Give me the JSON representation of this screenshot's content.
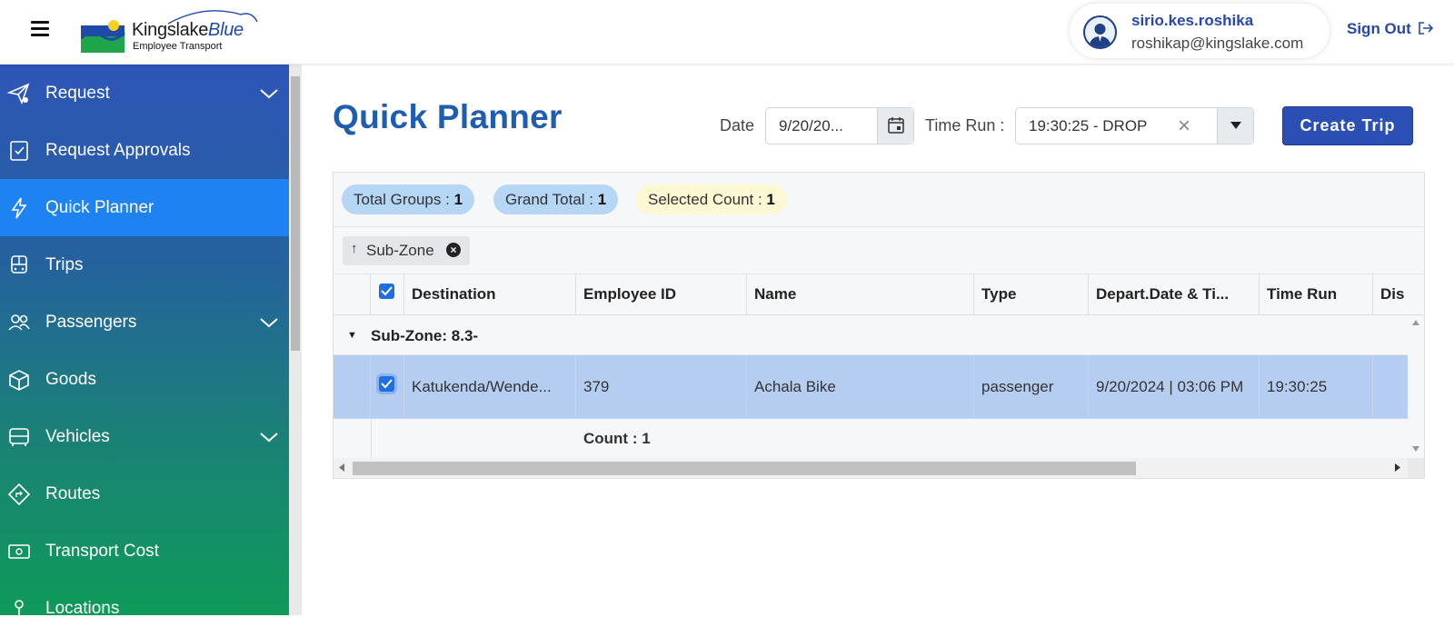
{
  "header": {
    "logo_title_main": "Kingslake",
    "logo_title_accent": "Blue",
    "logo_subtitle": "Employee Transport",
    "user_name": "sirio.kes.roshika",
    "user_email": "roshikap@kingslake.com",
    "signout_label": "Sign Out"
  },
  "sidebar": {
    "items": [
      {
        "label": "Request",
        "icon": "send-icon",
        "expandable": true
      },
      {
        "label": "Request Approvals",
        "icon": "approval-icon",
        "expandable": false
      },
      {
        "label": "Quick Planner",
        "icon": "lightning-icon",
        "expandable": false,
        "active": true
      },
      {
        "label": "Trips",
        "icon": "bus-front-icon",
        "expandable": false
      },
      {
        "label": "Passengers",
        "icon": "people-icon",
        "expandable": true
      },
      {
        "label": "Goods",
        "icon": "box-icon",
        "expandable": false
      },
      {
        "label": "Vehicles",
        "icon": "bus-icon",
        "expandable": true
      },
      {
        "label": "Routes",
        "icon": "route-sign-icon",
        "expandable": false
      },
      {
        "label": "Transport Cost",
        "icon": "cash-icon",
        "expandable": false
      },
      {
        "label": "Locations",
        "icon": "location-icon",
        "expandable": false
      }
    ],
    "active_color": "#1e82f2"
  },
  "page": {
    "title": "Quick Planner",
    "date_label": "Date",
    "date_value": "9/20/20...",
    "time_run_label": "Time Run :",
    "time_run_value": "19:30:25 - DROP",
    "create_trip_label": "Create Trip"
  },
  "summary": {
    "total_groups_label": "Total Groups : ",
    "total_groups_value": "1",
    "grand_total_label": "Grand Total : ",
    "grand_total_value": "1",
    "selected_count_label": "Selected Count : ",
    "selected_count_value": "1"
  },
  "group_chip": {
    "label": "Sub-Zone",
    "sort": "ascending"
  },
  "table": {
    "columns": [
      "Destination",
      "Employee ID",
      "Name",
      "Type",
      "Depart.Date & Ti...",
      "Time Run",
      "Dis"
    ],
    "group_row": "Sub-Zone: 8.3-",
    "rows": [
      {
        "selected": true,
        "destination": "Katukenda/Wende...",
        "employee_id": "379",
        "name": "Achala Bike",
        "type": "passenger",
        "depart": "9/20/2024 | 03:06 PM",
        "time_run": "19:30:25"
      }
    ],
    "footer_count": "Count : 1"
  }
}
